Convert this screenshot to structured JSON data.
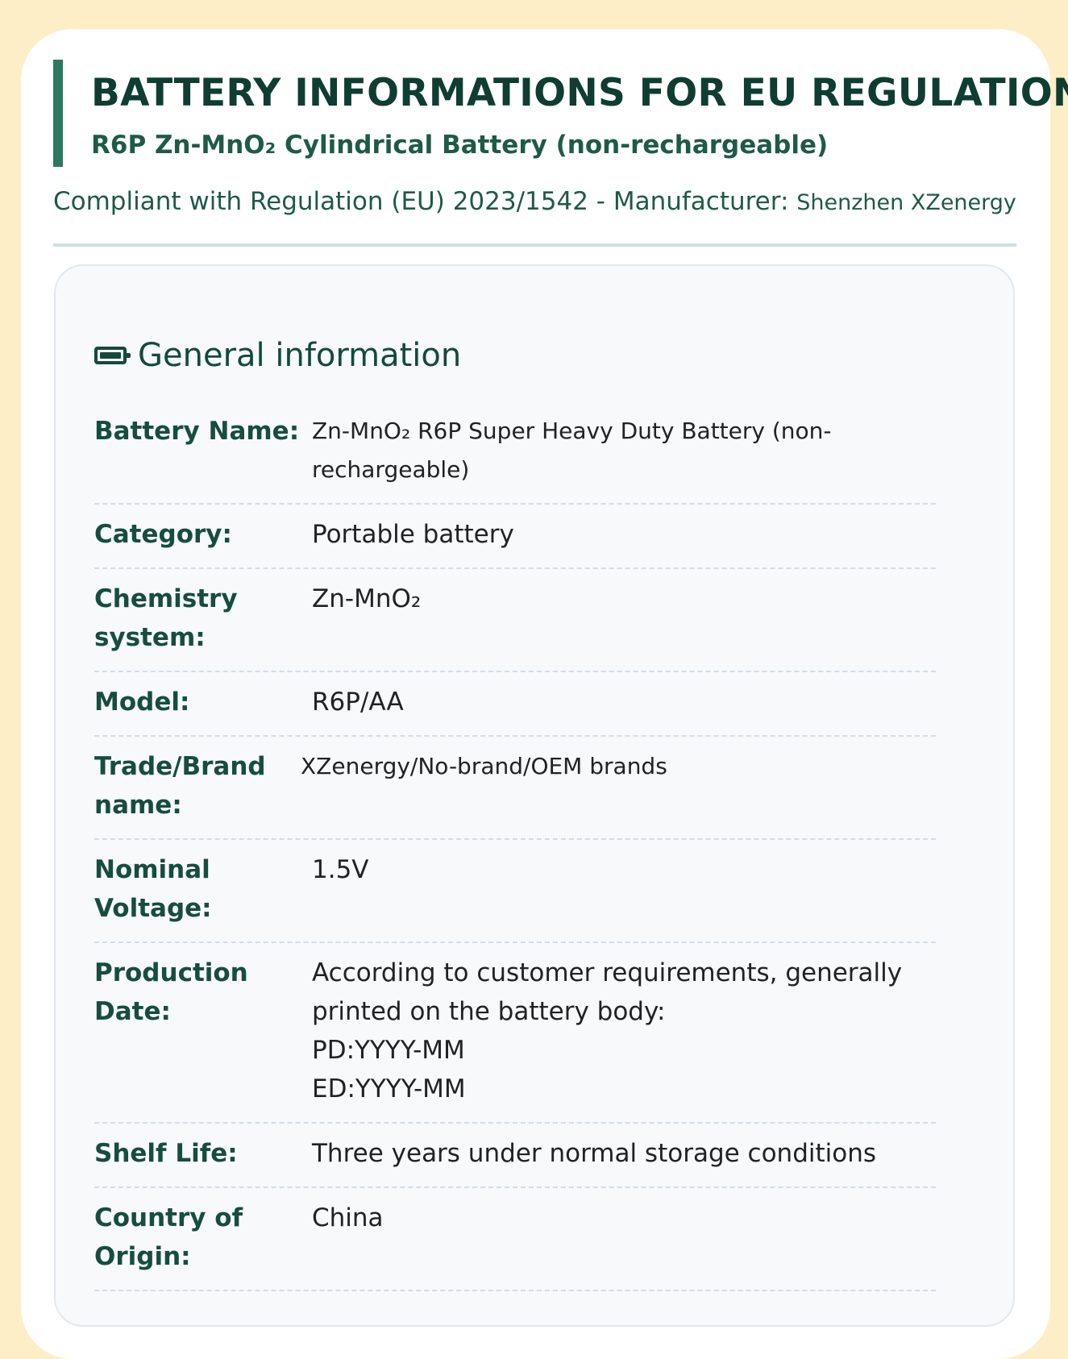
{
  "header": {
    "title": "BATTERY INFORMATIONS FOR EU REGULATION",
    "subtitle": "R6P Zn-MnO₂ Cylindrical Battery (non-rechargeable)",
    "compliance_prefix": "Compliant with Regulation (EU) 2023/1542 - Manufacturer:",
    "manufacturer": "Shenzhen XZenergy"
  },
  "general": {
    "icon": "battery-icon",
    "heading": "General information",
    "rows": [
      {
        "label": "Battery Name:",
        "value": "Zn-MnO₂ R6P Super Heavy Duty Battery (non-rechargeable)"
      },
      {
        "label": "Category:",
        "value": "Portable battery"
      },
      {
        "label": "Chemistry system:",
        "value": "Zn-MnO₂"
      },
      {
        "label": "Model:",
        "value": "R6P/AA"
      },
      {
        "label": "Trade/Brand name:",
        "value": "XZenergy/No-brand/OEM brands"
      },
      {
        "label": "Nominal Voltage:",
        "value": "1.5V"
      },
      {
        "label": "Production Date:",
        "value": "According to customer requirements, generally printed on the battery body:\nPD:YYYY-MM\nED:YYYY-MM"
      },
      {
        "label": "Shelf Life:",
        "value": "Three years under normal storage conditions"
      },
      {
        "label": "Country of Origin:",
        "value": "China"
      }
    ]
  },
  "colors": {
    "page_bg": "#fdeec8",
    "accent": "#2b7a60",
    "heading": "#0f3d31",
    "panel_bg": "#f7f9fb"
  }
}
